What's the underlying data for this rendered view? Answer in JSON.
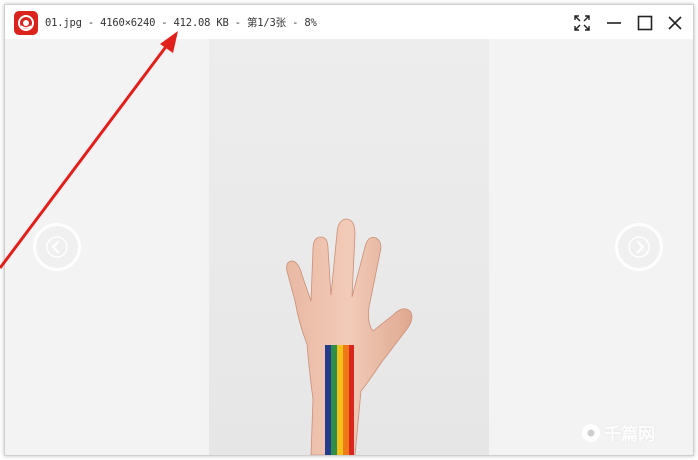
{
  "titlebar": {
    "title": "01.jpg - 4160×6240 - 412.08 KB - 第1/3张 - 8%",
    "icons": {
      "app": "app-logo-icon",
      "fullscreen": "fullscreen-icon",
      "minimize": "minimize-icon",
      "maximize": "maximize-icon",
      "close": "close-icon"
    }
  },
  "viewer": {
    "prev_icon": "chevron-left-icon",
    "next_icon": "chevron-right-icon",
    "photo_description_icon": "hand-rainbow-photo"
  },
  "watermark": {
    "text": "千篇网"
  },
  "colors": {
    "app_icon": "#d9231c",
    "annotation_arrow": "#e0201b",
    "viewer_bg": "#f3f3f3"
  }
}
